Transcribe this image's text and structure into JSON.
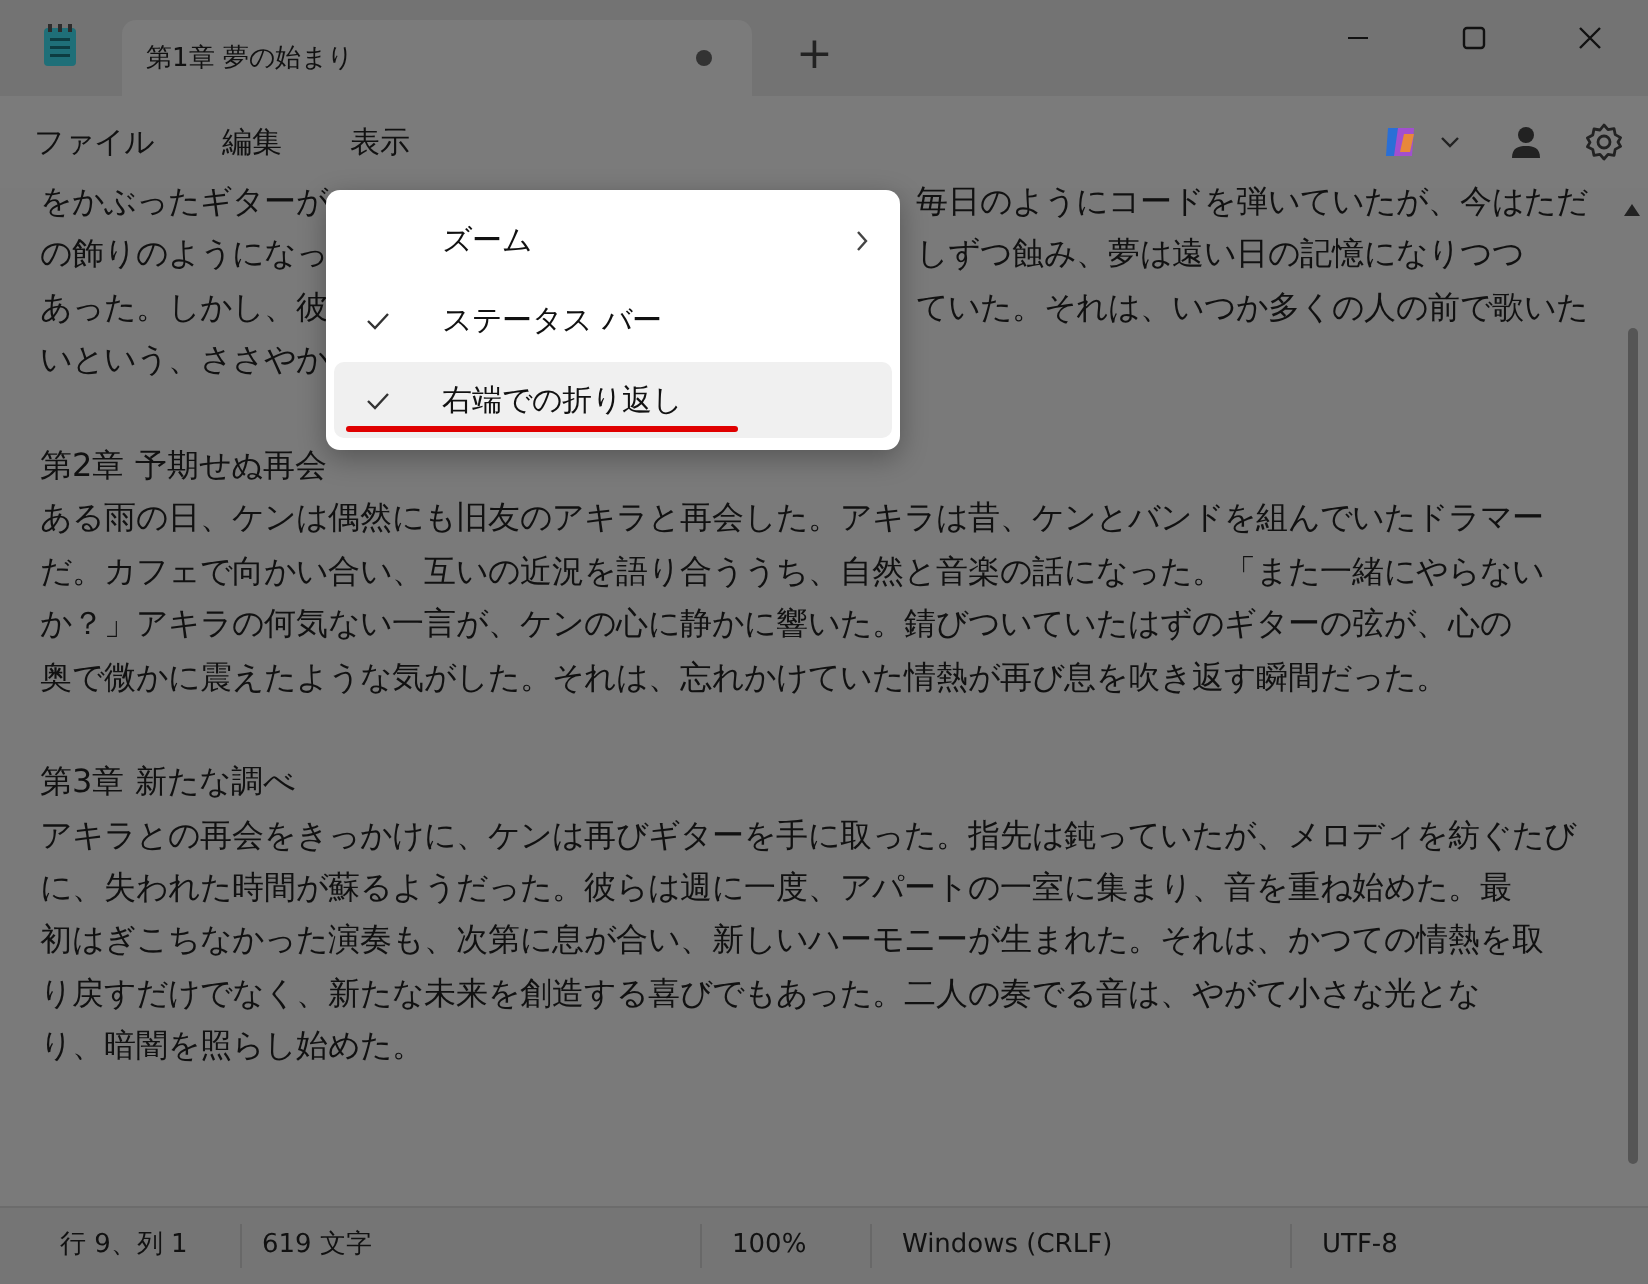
{
  "window": {
    "tab": {
      "title": "第1章 夢の始まり",
      "modified": true
    },
    "new_tab": "+"
  },
  "menubar": [
    "ファイル",
    "編集",
    "表示"
  ],
  "menu": {
    "items": [
      {
        "kind": "submenu",
        "label": "ズーム",
        "checked": false,
        "selected": false,
        "underlined": false
      },
      {
        "kind": "toggle",
        "label": "ステータス バー",
        "checked": true,
        "selected": false,
        "underlined": false
      },
      {
        "kind": "toggle",
        "label": "右端での折り返し",
        "checked": true,
        "selected": true,
        "underlined": true
      }
    ]
  },
  "document": {
    "sections": [
      {
        "kind": "partial",
        "lines": [
          {
            "left": "をかぶったギターが",
            "right": "毎日のようにコードを弾いていたが、今はただ"
          },
          {
            "left": "の飾りのようになっ",
            "right": "しずつ蝕み、夢は遠い日の記憶になりつつ"
          },
          {
            "left": "あった。しかし、彼",
            "right": "ていた。それは、いつか多くの人の前で歌いた"
          },
          {
            "left": "いという、ささやか"
          }
        ]
      },
      {
        "kind": "chapter",
        "heading": "第2章 予期せぬ再会",
        "lines": [
          "ある雨の日、ケンは偶然にも旧友のアキラと再会した。アキラは昔、ケンとバンドを組んでいたドラマー",
          "だ。カフェで向かい合い、互いの近況を語り合ううち、自然と音楽の話になった。「また一緒にやらない",
          "か？」アキラの何気ない一言が、ケンの心に静かに響いた。錆びついていたはずのギターの弦が、心の",
          "奥で微かに震えたような気がした。それは、忘れかけていた情熱が再び息を吹き返す瞬間だった。"
        ]
      },
      {
        "kind": "chapter",
        "heading": "第3章 新たな調べ",
        "lines": [
          "アキラとの再会をきっかけに、ケンは再びギターを手に取った。指先は鈍っていたが、メロディを紡ぐたび",
          "に、失われた時間が蘇るようだった。彼らは週に一度、アパートの一室に集まり、音を重ね始めた。最",
          "初はぎこちなかった演奏も、次第に息が合い、新しいハーモニーが生まれた。それは、かつての情熱を取",
          "り戻すだけでなく、新たな未来を創造する喜びでもあった。二人の奏でる音は、やがて小さな光とな",
          "り、暗闇を照らし始めた。"
        ]
      }
    ]
  },
  "status_bar": [
    "行 9、列 1",
    "619 文字",
    "100%",
    "Windows (CRLF)",
    "UTF-8"
  ]
}
